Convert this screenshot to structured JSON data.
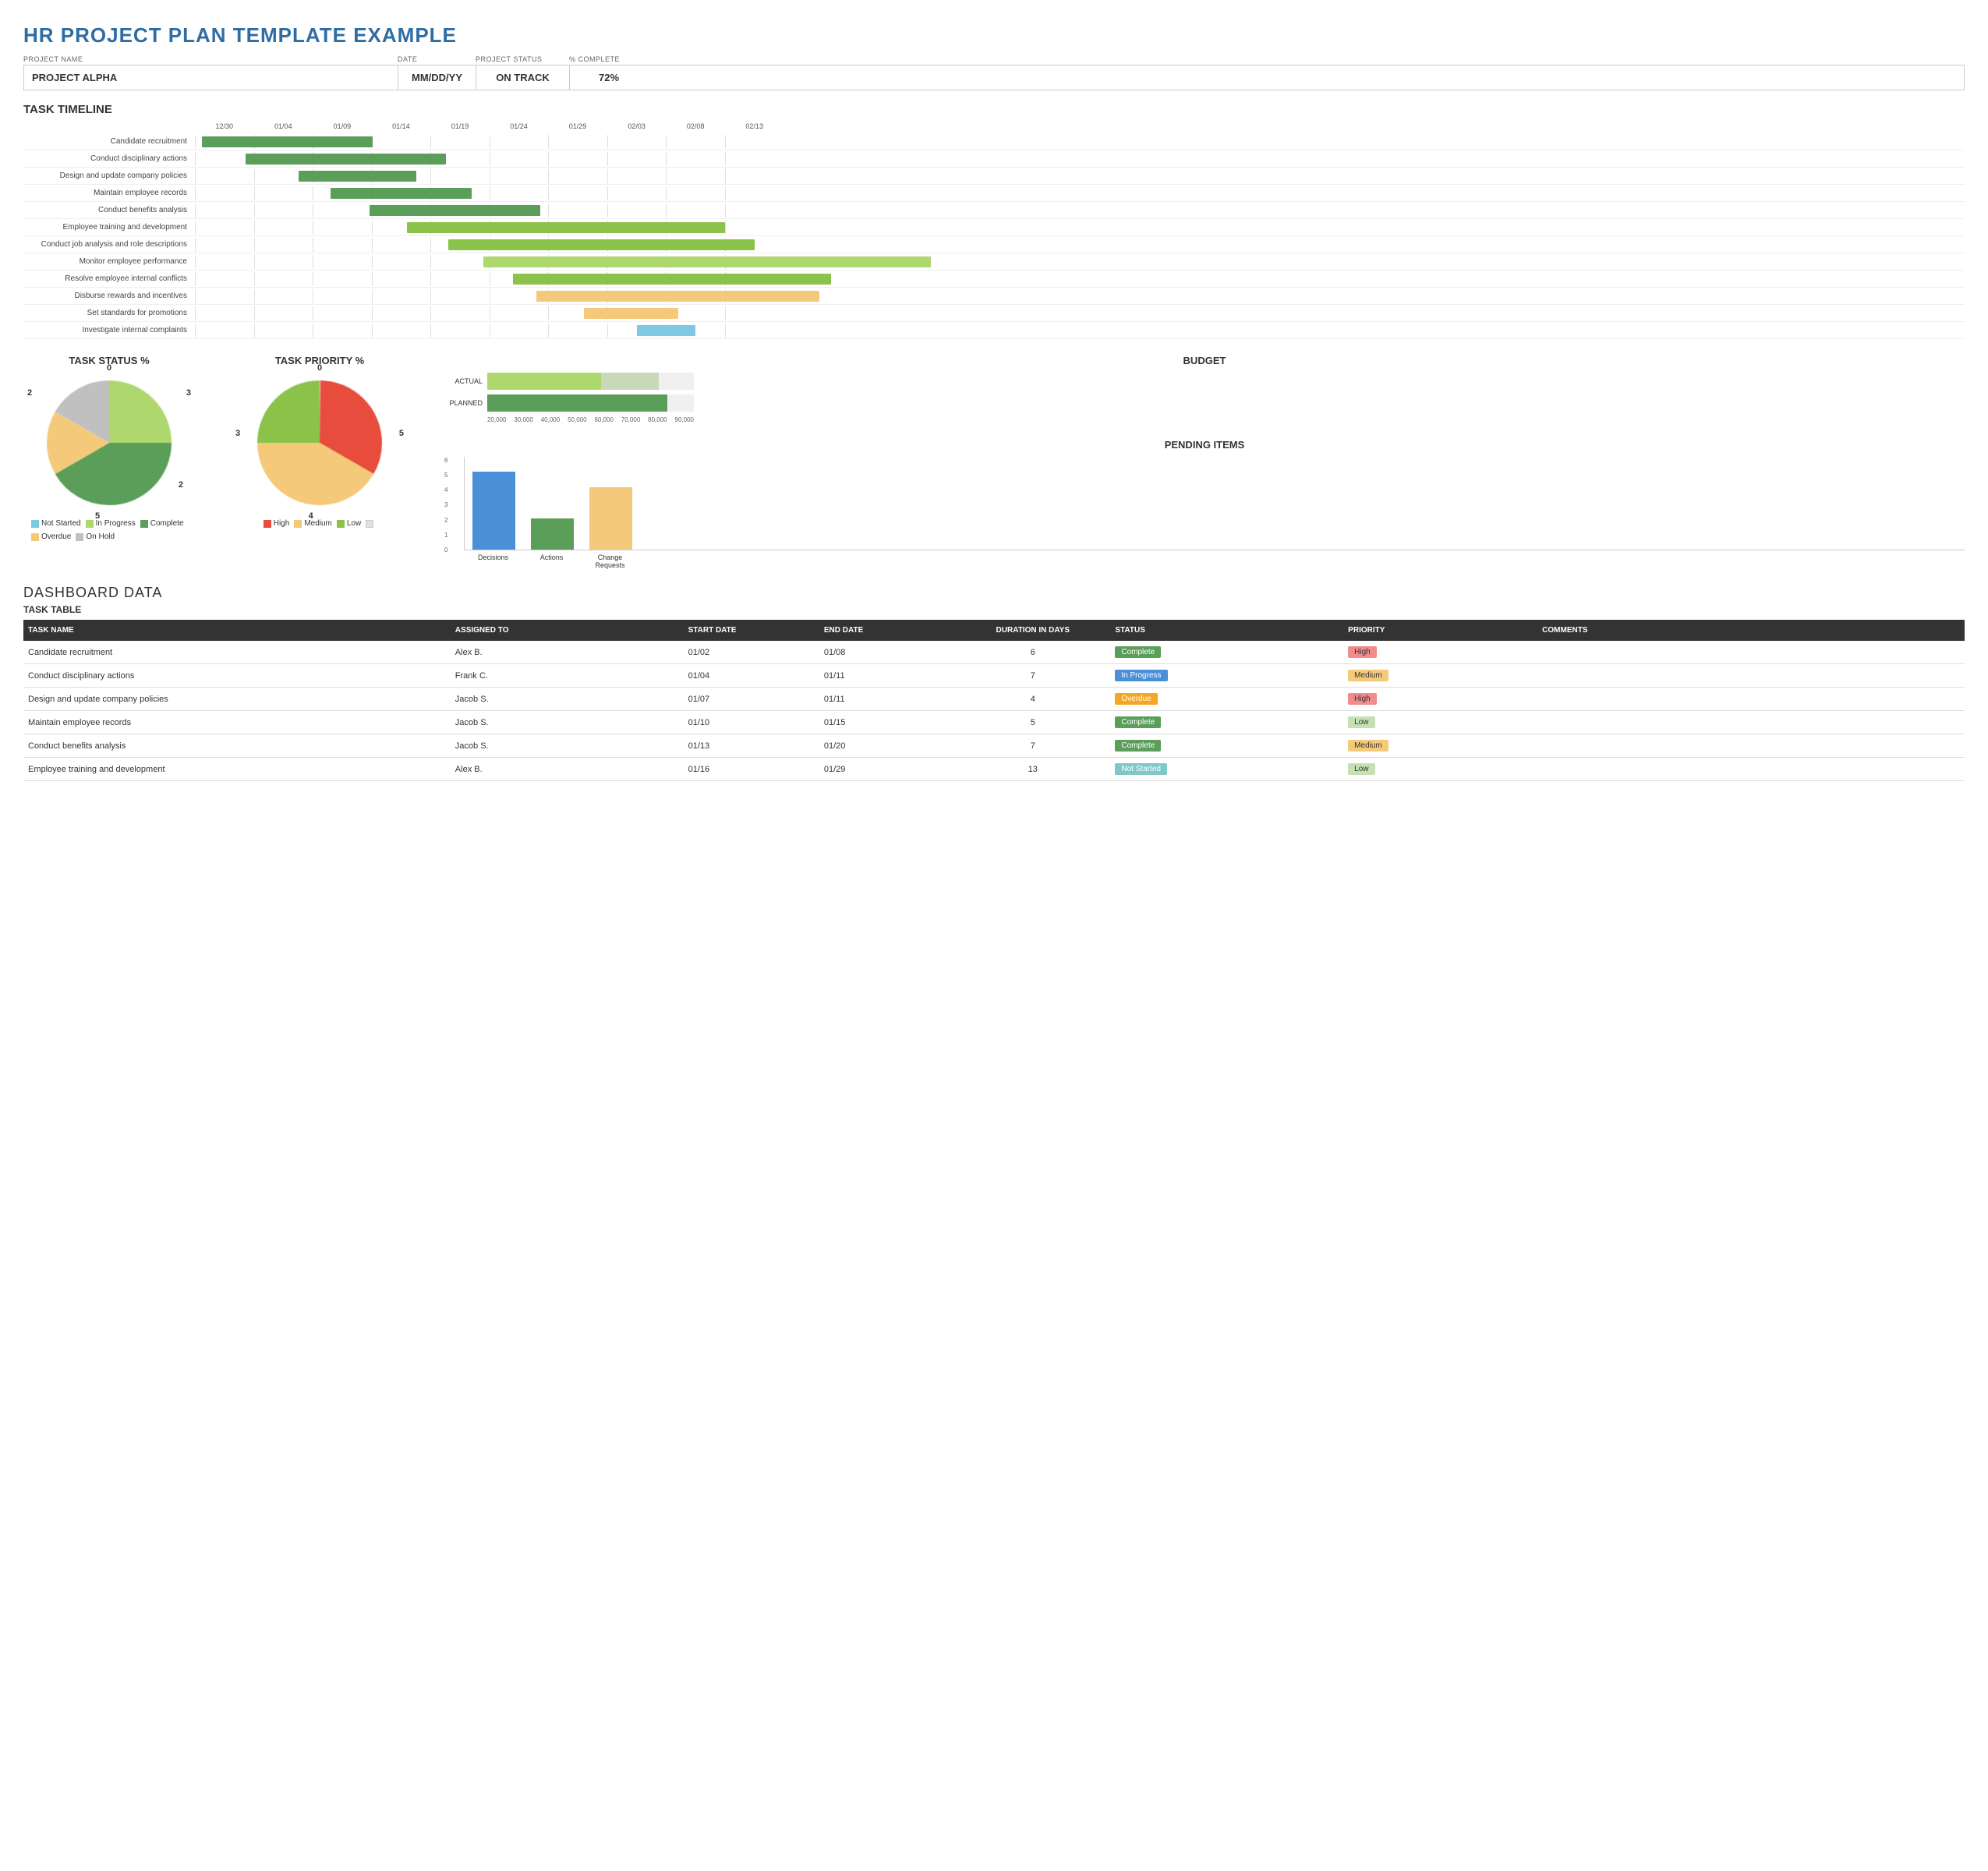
{
  "title": "HR PROJECT PLAN TEMPLATE EXAMPLE",
  "project": {
    "name_label": "PROJECT NAME",
    "date_label": "DATE",
    "status_label": "PROJECT STATUS",
    "complete_label": "% COMPLETE",
    "name": "PROJECT ALPHA",
    "date": "MM/DD/YY",
    "status": "ON TRACK",
    "complete": "72%"
  },
  "gantt": {
    "section_title": "TASK TIMELINE",
    "dates": [
      "12/30",
      "01/04",
      "01/09",
      "01/14",
      "01/19",
      "01/24",
      "01/29",
      "02/03",
      "02/08",
      "02/13"
    ],
    "tasks": [
      {
        "label": "Candidate recruitment",
        "start": 0.6,
        "width": 14.5,
        "color": "#5a9e5a"
      },
      {
        "label": "Conduct disciplinary actions",
        "start": 4.3,
        "width": 17.0,
        "color": "#5a9e5a"
      },
      {
        "label": "Design and update company policies",
        "start": 8.8,
        "width": 10.0,
        "color": "#5a9e5a"
      },
      {
        "label": "Maintain employee records",
        "start": 11.5,
        "width": 12.0,
        "color": "#5a9e5a"
      },
      {
        "label": "Conduct benefits analysis",
        "start": 14.8,
        "width": 14.5,
        "color": "#5a9e5a"
      },
      {
        "label": "Employee training and development",
        "start": 18.0,
        "width": 27.0,
        "color": "#8bc34a"
      },
      {
        "label": "Conduct job analysis and role descriptions",
        "start": 21.5,
        "width": 26.0,
        "color": "#8bc34a"
      },
      {
        "label": "Monitor employee performance",
        "start": 24.5,
        "width": 38.0,
        "color": "#aed86e"
      },
      {
        "label": "Resolve employee internal conflicts",
        "start": 27.0,
        "width": 27.0,
        "color": "#8bc34a"
      },
      {
        "label": "Disburse rewards and incentives",
        "start": 29.0,
        "width": 24.0,
        "color": "#f5c97a"
      },
      {
        "label": "Set standards for promotions",
        "start": 33.0,
        "width": 8.0,
        "color": "#f5c97a"
      },
      {
        "label": "Investigate internal complaints",
        "start": 37.5,
        "width": 5.0,
        "color": "#7ec8e3"
      }
    ]
  },
  "task_status": {
    "title": "TASK STATUS %",
    "segments": [
      {
        "label": "Not Started",
        "value": 0,
        "color": "#7ec8e3"
      },
      {
        "label": "In Progress",
        "value": 3,
        "color": "#aed86e"
      },
      {
        "label": "Complete",
        "value": 5,
        "color": "#5a9e5a"
      },
      {
        "label": "Overdue",
        "value": 2,
        "color": "#f5c97a"
      },
      {
        "label": "On Hold",
        "value": 2,
        "color": "#c0c0c0"
      }
    ],
    "labels_outside": {
      "top_left": "2",
      "top_right": "0",
      "right": "3",
      "bottom_right": "2",
      "bottom": "5"
    }
  },
  "task_priority": {
    "title": "TASK PRIORITY %",
    "segments": [
      {
        "label": "High",
        "value": 4,
        "color": "#e74c3c"
      },
      {
        "label": "Medium",
        "value": 5,
        "color": "#f5c97a"
      },
      {
        "label": "Low",
        "value": 3,
        "color": "#8bc34a"
      }
    ],
    "labels_outside": {
      "top": "0",
      "right": "5",
      "bottom": "4",
      "left": "3"
    }
  },
  "budget": {
    "title": "BUDGET",
    "rows": [
      {
        "label": "ACTUAL",
        "value": 45000,
        "max": 90000,
        "color": "#aed86e",
        "secondary_color": "#c8d8b8"
      },
      {
        "label": "PLANNED",
        "value": 78000,
        "max": 90000,
        "color": "#5a9e5a"
      }
    ],
    "axis": [
      "20,000",
      "30,000",
      "40,000",
      "50,000",
      "60,000",
      "70,000",
      "80,000",
      "90,000"
    ]
  },
  "pending": {
    "title": "PENDING ITEMS",
    "bars": [
      {
        "label": "Decisions",
        "value": 5,
        "color": "#4a90d9"
      },
      {
        "label": "Actions",
        "value": 2,
        "color": "#5a9e5a"
      },
      {
        "label": "Change Requests",
        "value": 4,
        "color": "#f5c97a"
      }
    ],
    "y_axis": [
      "0",
      "1",
      "2",
      "3",
      "4",
      "5",
      "6"
    ],
    "max": 6
  },
  "dashboard": {
    "title": "DASHBOARD DATA",
    "subtitle": "TASK TABLE",
    "columns": [
      "TASK NAME",
      "ASSIGNED TO",
      "START DATE",
      "END DATE",
      "DURATION in days",
      "STATUS",
      "PRIORITY",
      "COMMENTS"
    ],
    "rows": [
      {
        "name": "Candidate recruitment",
        "assigned": "Alex B.",
        "start": "01/02",
        "end": "01/08",
        "duration": 6,
        "status": "Complete",
        "priority": "High",
        "comments": ""
      },
      {
        "name": "Conduct disciplinary actions",
        "assigned": "Frank C.",
        "start": "01/04",
        "end": "01/11",
        "duration": 7,
        "status": "In Progress",
        "priority": "Medium",
        "comments": ""
      },
      {
        "name": "Design and update company policies",
        "assigned": "Jacob S.",
        "start": "01/07",
        "end": "01/11",
        "duration": 4,
        "status": "Overdue",
        "priority": "High",
        "comments": ""
      },
      {
        "name": "Maintain employee records",
        "assigned": "Jacob S.",
        "start": "01/10",
        "end": "01/15",
        "duration": 5,
        "status": "Complete",
        "priority": "Low",
        "comments": ""
      },
      {
        "name": "Conduct benefits analysis",
        "assigned": "Jacob S.",
        "start": "01/13",
        "end": "01/20",
        "duration": 7,
        "status": "Complete",
        "priority": "Medium",
        "comments": ""
      },
      {
        "name": "Employee training and development",
        "assigned": "Alex B.",
        "start": "01/16",
        "end": "01/29",
        "duration": 13,
        "status": "Not Started",
        "priority": "Low",
        "comments": ""
      }
    ]
  }
}
